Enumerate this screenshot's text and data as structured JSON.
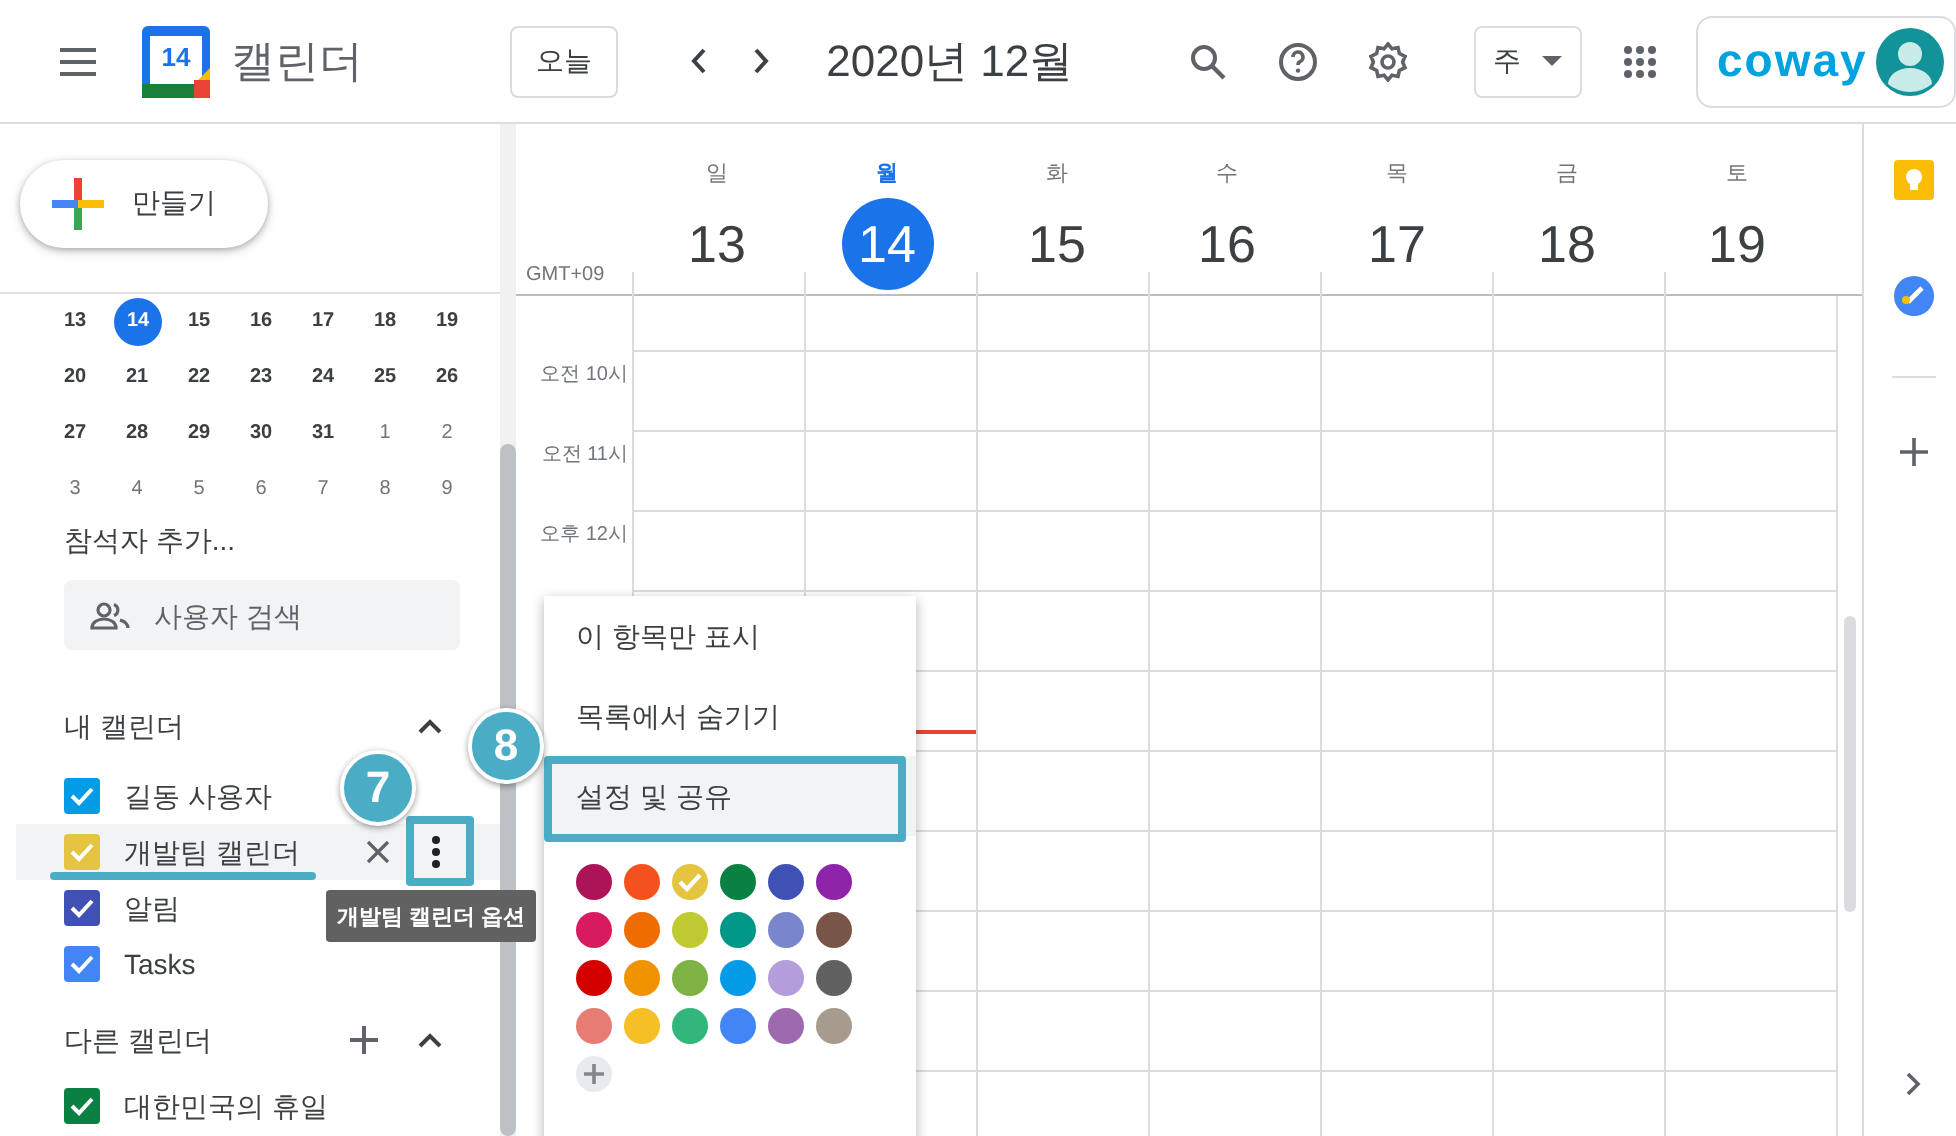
{
  "header": {
    "logo_date": "14",
    "app_name": "캘린더",
    "today_button": "오늘",
    "title": "2020년 12월",
    "view": "주",
    "account_logo": "coway"
  },
  "sidebar": {
    "create_button": "만들기",
    "mini_calendar": [
      [
        {
          "day": "13",
          "selected": false,
          "other_month": false
        },
        {
          "day": "14",
          "selected": true,
          "other_month": false
        },
        {
          "day": "15",
          "selected": false,
          "other_month": false
        },
        {
          "day": "16",
          "selected": false,
          "other_month": false
        },
        {
          "day": "17",
          "selected": false,
          "other_month": false
        },
        {
          "day": "18",
          "selected": false,
          "other_month": false
        },
        {
          "day": "19",
          "selected": false,
          "other_month": false
        }
      ],
      [
        {
          "day": "20",
          "selected": false,
          "other_month": false
        },
        {
          "day": "21",
          "selected": false,
          "other_month": false
        },
        {
          "day": "22",
          "selected": false,
          "other_month": false
        },
        {
          "day": "23",
          "selected": false,
          "other_month": false
        },
        {
          "day": "24",
          "selected": false,
          "other_month": false
        },
        {
          "day": "25",
          "selected": false,
          "other_month": false
        },
        {
          "day": "26",
          "selected": false,
          "other_month": false
        }
      ],
      [
        {
          "day": "27",
          "selected": false,
          "other_month": false
        },
        {
          "day": "28",
          "selected": false,
          "other_month": false
        },
        {
          "day": "29",
          "selected": false,
          "other_month": false
        },
        {
          "day": "30",
          "selected": false,
          "other_month": false
        },
        {
          "day": "31",
          "selected": false,
          "other_month": false
        },
        {
          "day": "1",
          "selected": false,
          "other_month": true
        },
        {
          "day": "2",
          "selected": false,
          "other_month": true
        }
      ],
      [
        {
          "day": "3",
          "selected": false,
          "other_month": true
        },
        {
          "day": "4",
          "selected": false,
          "other_month": true
        },
        {
          "day": "5",
          "selected": false,
          "other_month": true
        },
        {
          "day": "6",
          "selected": false,
          "other_month": true
        },
        {
          "day": "7",
          "selected": false,
          "other_month": true
        },
        {
          "day": "8",
          "selected": false,
          "other_month": true
        },
        {
          "day": "9",
          "selected": false,
          "other_month": true
        }
      ]
    ],
    "add_people": "참석자 추가...",
    "search": {
      "placeholder": "사용자 검색"
    }
  },
  "my_calendars": {
    "title": "내 캘린더",
    "items": [
      {
        "label": "길동 사용자",
        "color": "#039be5",
        "checked": true,
        "hovered": false
      },
      {
        "label": "개발팀 캘린더",
        "color": "#e4c441",
        "checked": true,
        "hovered": true
      },
      {
        "label": "알림",
        "color": "#3f51b5",
        "checked": true,
        "hovered": false
      },
      {
        "label": "Tasks",
        "color": "#4285f4",
        "checked": true,
        "hovered": false
      }
    ]
  },
  "tooltip": "개발팀 캘린더 옵션",
  "other_calendars": {
    "title": "다른 캘린더",
    "items": [
      {
        "label": "대한민국의 휴일",
        "color": "#0b8043",
        "checked": true,
        "hovered": false
      }
    ]
  },
  "week": {
    "timezone": "GMT+09",
    "days": [
      {
        "weekday": "일",
        "date": "13",
        "selected": false
      },
      {
        "weekday": "월",
        "date": "14",
        "selected": true
      },
      {
        "weekday": "화",
        "date": "15",
        "selected": false
      },
      {
        "weekday": "수",
        "date": "16",
        "selected": false
      },
      {
        "weekday": "목",
        "date": "17",
        "selected": false
      },
      {
        "weekday": "금",
        "date": "18",
        "selected": false
      },
      {
        "weekday": "토",
        "date": "19",
        "selected": false
      }
    ],
    "current_time_line": true,
    "times": [
      "오전 10시",
      "오전 11시",
      "오후 12시"
    ]
  },
  "menu": {
    "items": [
      {
        "label": "이 항목만 표시",
        "selected": false
      },
      {
        "label": "목록에서 숨기기",
        "selected": false
      },
      {
        "label": "설정 및 공유",
        "selected": true
      }
    ],
    "colors": [
      {
        "color": "#ad1457",
        "selected": false
      },
      {
        "color": "#f4511e",
        "selected": false
      },
      {
        "color": "#e4c441",
        "selected": true
      },
      {
        "color": "#0b8043",
        "selected": false
      },
      {
        "color": "#3f51b5",
        "selected": false
      },
      {
        "color": "#8e24aa",
        "selected": false
      },
      {
        "color": "#d81b60",
        "selected": false
      },
      {
        "color": "#ef6c00",
        "selected": false
      },
      {
        "color": "#c0ca33",
        "selected": false
      },
      {
        "color": "#009688",
        "selected": false
      },
      {
        "color": "#7986cb",
        "selected": false
      },
      {
        "color": "#795548",
        "selected": false
      },
      {
        "color": "#d50000",
        "selected": false
      },
      {
        "color": "#f09300",
        "selected": false
      },
      {
        "color": "#7cb342",
        "selected": false
      },
      {
        "color": "#039be5",
        "selected": false
      },
      {
        "color": "#b39ddb",
        "selected": false
      },
      {
        "color": "#616161",
        "selected": false
      },
      {
        "color": "#e67c73",
        "selected": false
      },
      {
        "color": "#f6bf26",
        "selected": false
      },
      {
        "color": "#33b679",
        "selected": false
      },
      {
        "color": "#4285f4",
        "selected": false
      },
      {
        "color": "#9e69af",
        "selected": false
      },
      {
        "color": "#a79b8e",
        "selected": false
      }
    ]
  },
  "annotations": [
    {
      "number": "7"
    },
    {
      "number": "8"
    }
  ]
}
